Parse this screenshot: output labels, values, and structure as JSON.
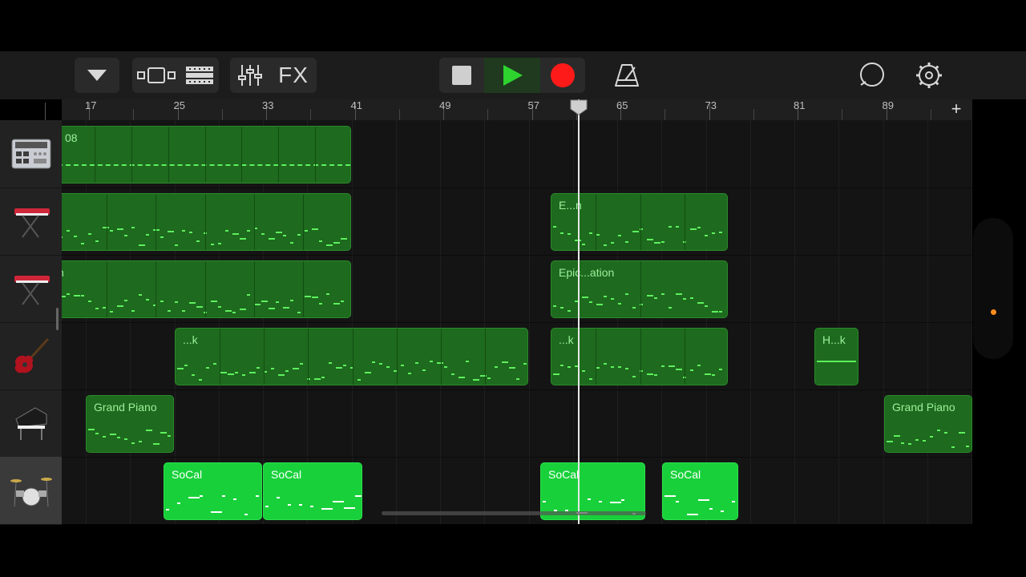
{
  "toolbar": {
    "fx_label": "FX"
  },
  "ruler": {
    "bars": [
      "17",
      "25",
      "33",
      "41",
      "49",
      "57",
      "65",
      "73",
      "81",
      "89"
    ],
    "add_label": "+"
  },
  "tracks": [
    {
      "id": "drum-machine",
      "icon": "drum-machine-icon"
    },
    {
      "id": "synth-1",
      "icon": "keyboard-synth-icon"
    },
    {
      "id": "synth-2",
      "icon": "keyboard-synth-icon"
    },
    {
      "id": "bass-guitar",
      "icon": "electric-guitar-icon"
    },
    {
      "id": "grand-piano",
      "icon": "grand-piano-icon"
    },
    {
      "id": "drums",
      "icon": "drum-kit-icon"
    }
  ],
  "regions": {
    "t0_r0": "08",
    "t1_r1": "E...n",
    "t2_r0": "n",
    "t2_r1": "Epic...ation",
    "t3_r0": "...k",
    "t3_r1": "...k",
    "t3_r2": "H...k",
    "t4_r0": "Grand Piano",
    "t4_r1": "Grand Piano",
    "t5_r0": "SoCal",
    "t5_r1": "SoCal",
    "t5_r2": "SoCal",
    "t5_r3": "SoCal"
  },
  "colors": {
    "region": "#1e6a1e",
    "drum_region": "#18d13a",
    "record": "#ff1a1a",
    "play": "#2ed32e",
    "track_indicator": "#ff8c1a"
  }
}
